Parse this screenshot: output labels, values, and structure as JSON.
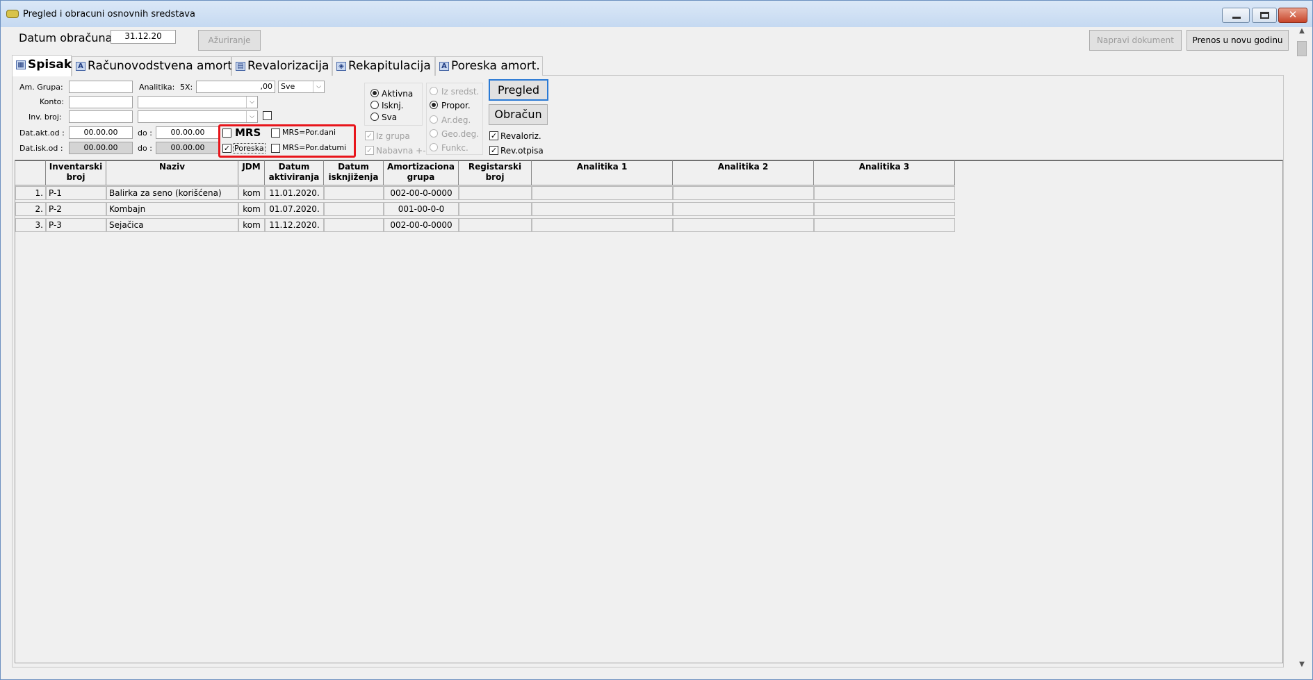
{
  "window": {
    "title": "Pregled i obracuni osnovnih sredstava",
    "minimize_icon": "minimize-icon",
    "maximize_icon": "maximize-icon",
    "close_icon": "close-icon",
    "close_glyph": "✕"
  },
  "top": {
    "datum_label": "Datum obračuna:",
    "datum_value": "31.12.20",
    "azuriranje_label": "Ažuriranje",
    "napravi_label": "Napravi dokument",
    "prenos_label": "Prenos u novu godinu"
  },
  "tabs": [
    {
      "label": "Spisak",
      "icon": "list-icon",
      "glyph": "▦"
    },
    {
      "label": "Računovodstvena amort.",
      "icon": "letter-a-icon",
      "glyph": "A"
    },
    {
      "label": "Revalorizacija",
      "icon": "grid-icon",
      "glyph": "▤"
    },
    {
      "label": "Rekapitulacija",
      "icon": "chart-icon",
      "glyph": "◈"
    },
    {
      "label": "Poreska amort.",
      "icon": "letter-a-icon",
      "glyph": "A"
    }
  ],
  "filters": {
    "am_grupa_label": "Am. Grupa:",
    "analitika_label": "Analitika:",
    "fivex_label": "5X:",
    "fivex_value": ",00",
    "sve_value": "Sve",
    "konto_label": "Konto:",
    "inv_broj_label": "Inv. broj:",
    "dat_akt_od_label": "Dat.akt.od :",
    "dat_akt_od_value": "00.00.00",
    "do_label": "do :",
    "dat_akt_do_value": "00.00.00",
    "dat_isk_od_label": "Dat.isk.od :",
    "dat_isk_od_value": "00.00.00",
    "dat_isk_do_value": "00.00.00",
    "dropdown_glyph": "⌵",
    "check_glyph": "✓"
  },
  "mrs_box": {
    "mrs_label": "MRS",
    "mrs_por_dani_label": "MRS=Por.dani",
    "poreska_label": "Poreska",
    "mrs_por_datumi_label": "MRS=Por.datumi"
  },
  "status_radios": {
    "aktivna": "Aktivna",
    "isknj": "Isknj.",
    "sva": "Sva"
  },
  "extra_checks": {
    "iz_grupa": "Iz grupa",
    "nabavna": "Nabavna +-"
  },
  "method_radios": {
    "iz_sredst": "Iz sredst.",
    "propor": "Propor.",
    "ar_deg": "Ar.deg.",
    "geo_deg": "Geo.deg.",
    "funkc": "Funkc."
  },
  "actions": {
    "pregled": "Pregled",
    "obracun": "Obračun",
    "revaloriz": "Revaloriz.",
    "rev_otpisa": "Rev.otpisa"
  },
  "table": {
    "columns": [
      {
        "line1": "Inventarski",
        "line2": "broj"
      },
      {
        "line1": "Naziv",
        "line2": ""
      },
      {
        "line1": "JDM",
        "line2": ""
      },
      {
        "line1": "Datum",
        "line2": "aktiviranja"
      },
      {
        "line1": "Datum",
        "line2": "isknjiženja"
      },
      {
        "line1": "Amortizaciona",
        "line2": "grupa"
      },
      {
        "line1": "Registarski broj",
        "line2": ""
      },
      {
        "line1": "Analitika 1",
        "line2": ""
      },
      {
        "line1": "Analitika 2",
        "line2": ""
      },
      {
        "line1": "Analitika 3",
        "line2": ""
      }
    ],
    "rows": [
      {
        "rn": "1.",
        "inv": "P-1",
        "naziv": "Balirka za seno (korišćena)",
        "jdm": "kom",
        "dat_akt": "11.01.2020.",
        "dat_isk": "",
        "grupa": "002-00-0-0000",
        "reg": "",
        "a1": "",
        "a2": "",
        "a3": ""
      },
      {
        "rn": "2.",
        "inv": "P-2",
        "naziv": "Kombajn",
        "jdm": "kom",
        "dat_akt": "01.07.2020.",
        "dat_isk": "",
        "grupa": "001-00-0-0",
        "reg": "",
        "a1": "",
        "a2": "",
        "a3": ""
      },
      {
        "rn": "3.",
        "inv": "P-3",
        "naziv": "Sejačica",
        "jdm": "kom",
        "dat_akt": "11.12.2020.",
        "dat_isk": "",
        "grupa": "002-00-0-0000",
        "reg": "",
        "a1": "",
        "a2": "",
        "a3": ""
      }
    ]
  },
  "scrollbar": {
    "up_glyph": "▲",
    "down_glyph": "▼"
  },
  "colors": {
    "highlight": "#e8151b",
    "primary_button_border": "#2a7ad5"
  }
}
